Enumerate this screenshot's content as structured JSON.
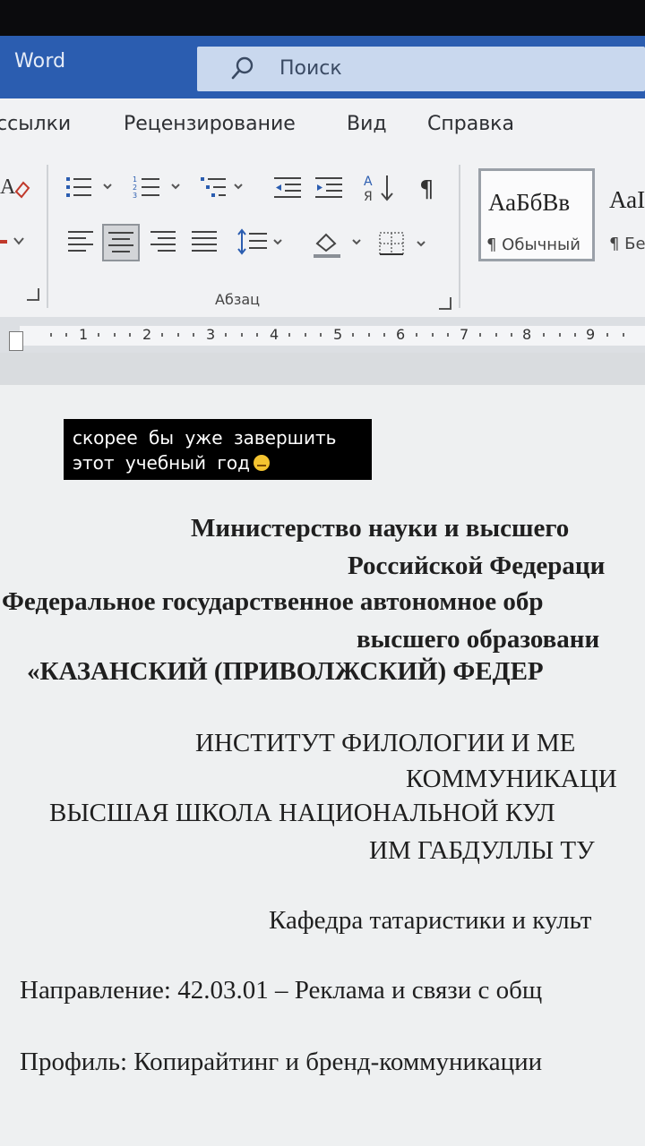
{
  "window": {
    "app_title": "Word"
  },
  "search": {
    "label": "Поиск",
    "icon": "search-icon"
  },
  "menu": {
    "items": [
      "ссылки",
      "Рецензирование",
      "Вид",
      "Справка"
    ]
  },
  "ribbon": {
    "paragraph_group_label": "Абзац",
    "styles": [
      {
        "sample": "АаБбВв",
        "name": "¶ Обычный"
      },
      {
        "sample": "АаI",
        "name": "¶ Бе"
      }
    ]
  },
  "ruler": {
    "numbers": [
      "1",
      "2",
      "3",
      "4",
      "5",
      "6",
      "7",
      "8",
      "9"
    ]
  },
  "caption": {
    "line1": "скорее бы уже завершить",
    "line2": "этот учебный год"
  },
  "document": {
    "lines": [
      "Министерство науки и высшего",
      "Российской Федераци",
      "Федеральное государственное автономное обр",
      "высшего образовани",
      "«КАЗАНСКИЙ (ПРИВОЛЖСКИЙ) ФЕДЕР",
      "ИНСТИТУТ ФИЛОЛОГИИ И МЕ",
      "КОММУНИКАЦИ",
      "ВЫСШАЯ ШКОЛА НАЦИОНАЛЬНОЙ КУЛ",
      "ИМ ГАБДУЛЛЫ ТУ",
      "Кафедра татаристики и культ",
      "Направление: 42.03.01 – Реклама и связи с общ",
      "Профиль: Копирайтинг и бренд-коммуникации"
    ]
  },
  "colors": {
    "titlebar": "#2b5db0",
    "searchbox": "#c9d8ee",
    "ribbon": "#f1f2f4",
    "caption_bg": "#000000",
    "caption_text": "#ffffff"
  }
}
